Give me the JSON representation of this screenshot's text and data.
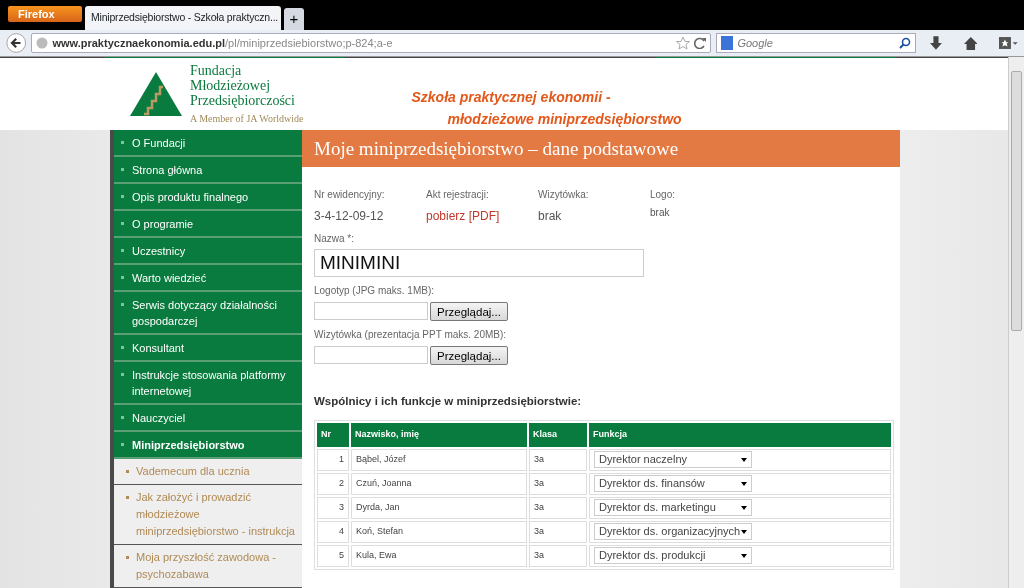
{
  "browser": {
    "menu_button": "Firefox",
    "tab_title": "Miniprzedsiębiorstwo - Szkoła praktyczn...",
    "new_tab": "+",
    "url_host": "www.praktycznaekonomia.edu.pl",
    "url_path": "/pl/miniprzedsiebiorstwo;p-824;a-e",
    "search_placeholder": "Google"
  },
  "header": {
    "org_name_lines": [
      "Fundacja",
      "Młodzieżowej",
      "Przedsiębiorczości"
    ],
    "org_tagline": "A Member of JA Worldwide",
    "slogan_lines": [
      "Szkoła praktycznej ekonomii -",
      "młodzieżowe miniprzedsiębiorstwo"
    ]
  },
  "sidebar": {
    "items": [
      {
        "label": "O Fundacji",
        "selected": false
      },
      {
        "label": "Strona główna",
        "selected": false
      },
      {
        "label": "Opis produktu finalnego",
        "selected": false
      },
      {
        "label": "O programie",
        "selected": false
      },
      {
        "label": "Uczestnicy",
        "selected": false
      },
      {
        "label": "Warto wiedzieć",
        "selected": false
      },
      {
        "label": "Serwis dotyczący działalności gospodarczej",
        "selected": false
      },
      {
        "label": "Konsultant",
        "selected": false
      },
      {
        "label": "Instrukcje stosowania platformy internetowej",
        "selected": false
      },
      {
        "label": "Nauczyciel",
        "selected": false
      },
      {
        "label": "Miniprzedsiębiorstwo",
        "selected": true,
        "children": [
          {
            "label": "Vademecum dla ucznia"
          },
          {
            "label": "Jak założyć i prowadzić młodzieżowe miniprzedsiębiorstwo - instrukcja"
          },
          {
            "label": "Moja przyszłość zawodowa - psychozabawa"
          }
        ]
      }
    ]
  },
  "content": {
    "title": "Moje miniprzedsiębiorstwo – dane podstawowe",
    "info": [
      {
        "label": "Nr ewidencyjny:",
        "value": "3-4-12-09-12",
        "kind": "text"
      },
      {
        "label": "Akt rejestracji:",
        "value": "pobierz [PDF]",
        "kind": "link"
      },
      {
        "label": "Wizytówka:",
        "value": "brak",
        "kind": "text"
      },
      {
        "label": "Logo:",
        "value": "brak",
        "kind": "small"
      }
    ],
    "name_field": {
      "label": "Nazwa *:",
      "value": "MINIMINI"
    },
    "uploads": [
      {
        "label": "Logotyp (JPG maks. 1MB):",
        "button": "Przeglądaj..."
      },
      {
        "label": "Wizytówka (prezentacja PPT maks. 20MB):",
        "button": "Przeglądaj..."
      }
    ],
    "partners_heading": "Wspólnicy i ich funkcje w miniprzedsiębiorstwie:",
    "table": {
      "columns": [
        "Nr",
        "Nazwisko, imię",
        "Klasa",
        "Funkcja"
      ],
      "rows": [
        {
          "nr": "1",
          "name": "Bąbel, Józef",
          "klasa": "3a",
          "funkcja": "Dyrektor naczelny"
        },
        {
          "nr": "2",
          "name": "Czuń, Joanna",
          "klasa": "3a",
          "funkcja": "Dyrektor ds. finansów"
        },
        {
          "nr": "3",
          "name": "Dyrda, Jan",
          "klasa": "3a",
          "funkcja": "Dyrektor ds. marketingu"
        },
        {
          "nr": "4",
          "name": "Koń, Stefan",
          "klasa": "3a",
          "funkcja": "Dyrektor ds. organizacyjnych"
        },
        {
          "nr": "5",
          "name": "Kula, Ewa",
          "klasa": "3a",
          "funkcja": "Dyrektor ds. produkcji"
        }
      ]
    }
  }
}
